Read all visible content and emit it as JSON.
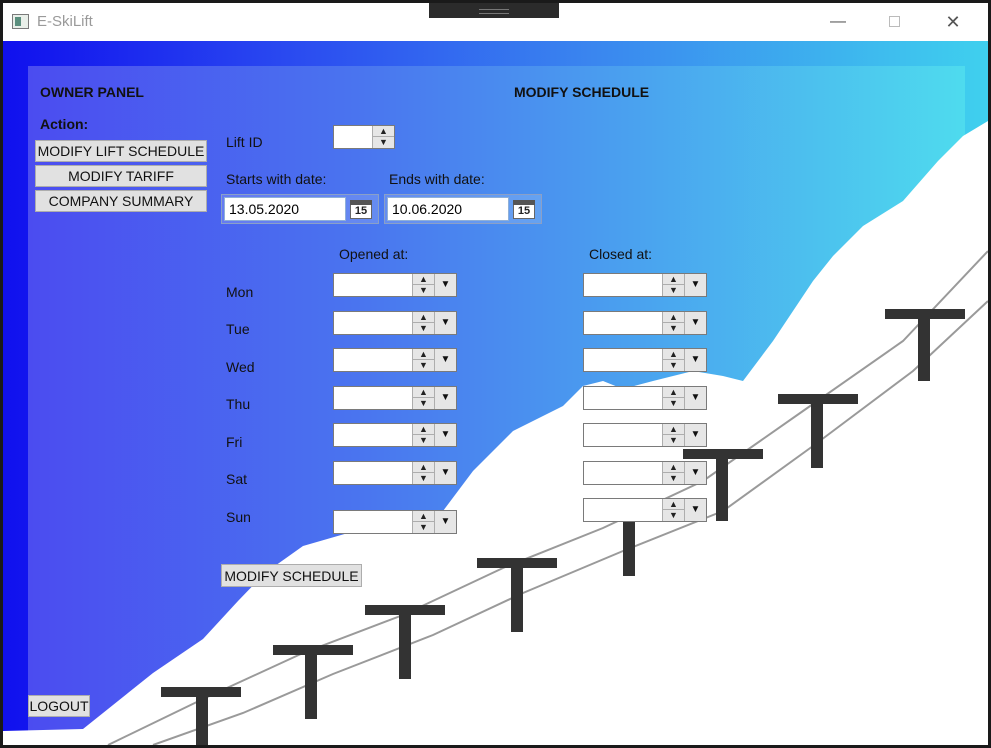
{
  "window": {
    "title": "E-SkiLift"
  },
  "titlebar": {
    "minimize_glyph": "—",
    "close_glyph": "✕"
  },
  "sidebar": {
    "heading": "OWNER PANEL",
    "action_label": "Action:",
    "buttons": [
      {
        "label": "MODIFY LIFT SCHEDULE"
      },
      {
        "label": "MODIFY TARIFF"
      },
      {
        "label": "COMPANY SUMMARY"
      }
    ],
    "logout_label": "LOGOUT"
  },
  "main": {
    "heading": "MODIFY SCHEDULE",
    "lift_id": {
      "label": "Lift ID",
      "value": ""
    },
    "start_date": {
      "label": "Starts with date:",
      "value": "13.05.2020",
      "calendar_day": "15"
    },
    "end_date": {
      "label": "Ends with date:",
      "value": "10.06.2020",
      "calendar_day": "15"
    },
    "opened_header": "Opened at:",
    "closed_header": "Closed at:",
    "days": [
      {
        "label": "Mon",
        "opened": "",
        "closed": ""
      },
      {
        "label": "Tue",
        "opened": "",
        "closed": ""
      },
      {
        "label": "Wed",
        "opened": "",
        "closed": ""
      },
      {
        "label": "Thu",
        "opened": "",
        "closed": ""
      },
      {
        "label": "Fri",
        "opened": "",
        "closed": ""
      },
      {
        "label": "Sat",
        "opened": "",
        "closed": ""
      },
      {
        "label": "Sun",
        "opened": "",
        "closed": ""
      }
    ],
    "submit_label": "MODIFY SCHEDULE"
  },
  "icons": {
    "spin_up": "▲",
    "spin_down": "▼",
    "dropdown": "▼"
  },
  "colors": {
    "gradient_left": "#1010ee",
    "gradient_right": "#3fd0ee",
    "snow": "#ffffff",
    "pylon": "#333333"
  }
}
